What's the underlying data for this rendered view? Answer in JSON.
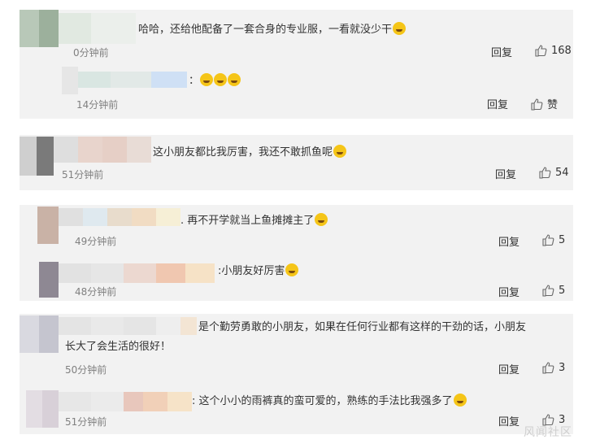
{
  "comments": [
    {
      "text": "哈哈，还给他配备了一套合身的专业服，一看就没少干",
      "time": "0分钟前",
      "reply": "回复",
      "likes": "168"
    },
    {
      "text": "：",
      "time": "14分钟前",
      "reply": "回复",
      "likes": "赞"
    },
    {
      "text": "这小朋友都比我厉害，我还不敢抓鱼呢",
      "time": "51分钟前",
      "reply": "回复",
      "likes": "54"
    },
    {
      "text": ". 再不开学就当上鱼摊摊主了",
      "time": "49分钟前",
      "reply": "回复",
      "likes": "5"
    },
    {
      "text": ":小朋友好厉害",
      "time": "48分钟前",
      "reply": "回复",
      "likes": "5"
    },
    {
      "text_line1": "是个勤劳勇敢的小朋友，如果在任何行业都有这样的干劲的话，小朋友",
      "text_line2": "长大了会生活的很好！",
      "time": "50分钟前",
      "reply": "回复",
      "likes": "3"
    },
    {
      "text": ": 这个小小的雨裤真的蛮可爱的，熟练的手法比我强多了",
      "time": "51分钟前",
      "reply": "回复",
      "likes": "3"
    }
  ],
  "watermark": "风闻社区"
}
